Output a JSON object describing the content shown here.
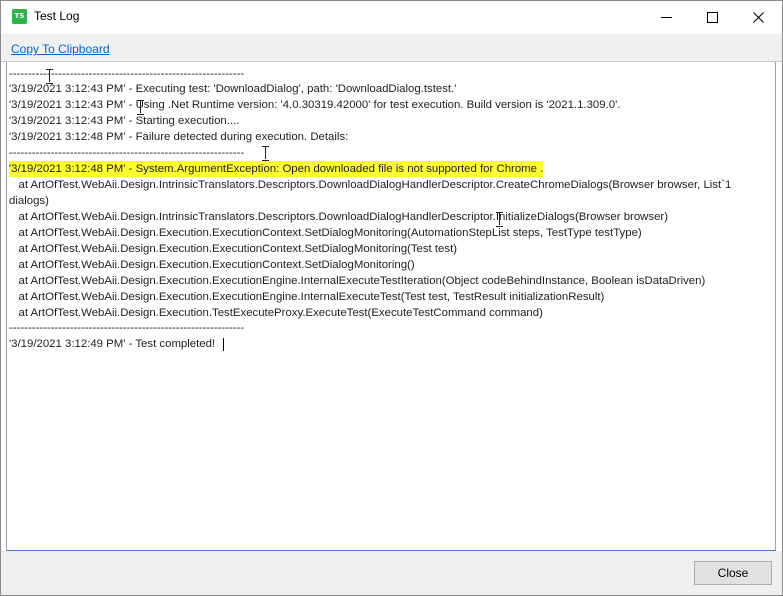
{
  "window": {
    "title": "Test Log",
    "app_icon_text": "TS",
    "icon_color": "#2eb24a"
  },
  "toolbar": {
    "copy_label": "Copy To Clipboard"
  },
  "log": {
    "separator": "--------------------------------------------------------------",
    "lines": [
      "'3/19/2021 3:12:43 PM' - Executing test: 'DownloadDialog', path: 'DownloadDialog.tstest.'",
      "'3/19/2021 3:12:43 PM' - Using .Net Runtime version: '4.0.30319.42000' for test execution. Build version is '2021.1.309.0'.",
      "'3/19/2021 3:12:43 PM' - Starting execution....",
      "'3/19/2021 3:12:48 PM' - Failure detected during execution. Details:",
      "'3/19/2021 3:12:48 PM' - System.ArgumentException: Open downloaded file is not supported for Chrome .",
      "   at ArtOfTest.WebAii.Design.IntrinsicTranslators.Descriptors.DownloadDialogHandlerDescriptor.CreateChromeDialogs(Browser browser, List`1",
      "dialogs)",
      "   at ArtOfTest.WebAii.Design.IntrinsicTranslators.Descriptors.DownloadDialogHandlerDescriptor.InitializeDialogs(Browser browser)",
      "   at ArtOfTest.WebAii.Design.Execution.ExecutionContext.SetDialogMonitoring(AutomationStepList steps, TestType testType)",
      "   at ArtOfTest.WebAii.Design.Execution.ExecutionContext.SetDialogMonitoring(Test test)",
      "   at ArtOfTest.WebAii.Design.Execution.ExecutionContext.SetDialogMonitoring()",
      "   at ArtOfTest.WebAii.Design.Execution.ExecutionEngine.InternalExecuteTestIteration(Object codeBehindInstance, Boolean isDataDriven)",
      "   at ArtOfTest.WebAii.Design.Execution.ExecutionEngine.InternalExecuteTest(Test test, TestResult initializationResult)",
      "   at ArtOfTest.WebAii.Design.Execution.TestExecuteProxy.ExecuteTest(ExecuteTestCommand command)",
      "'3/19/2021 3:12:49 PM' - Test completed!"
    ],
    "highlight_color": "#ffff2e"
  },
  "footer": {
    "close_label": "Close"
  }
}
